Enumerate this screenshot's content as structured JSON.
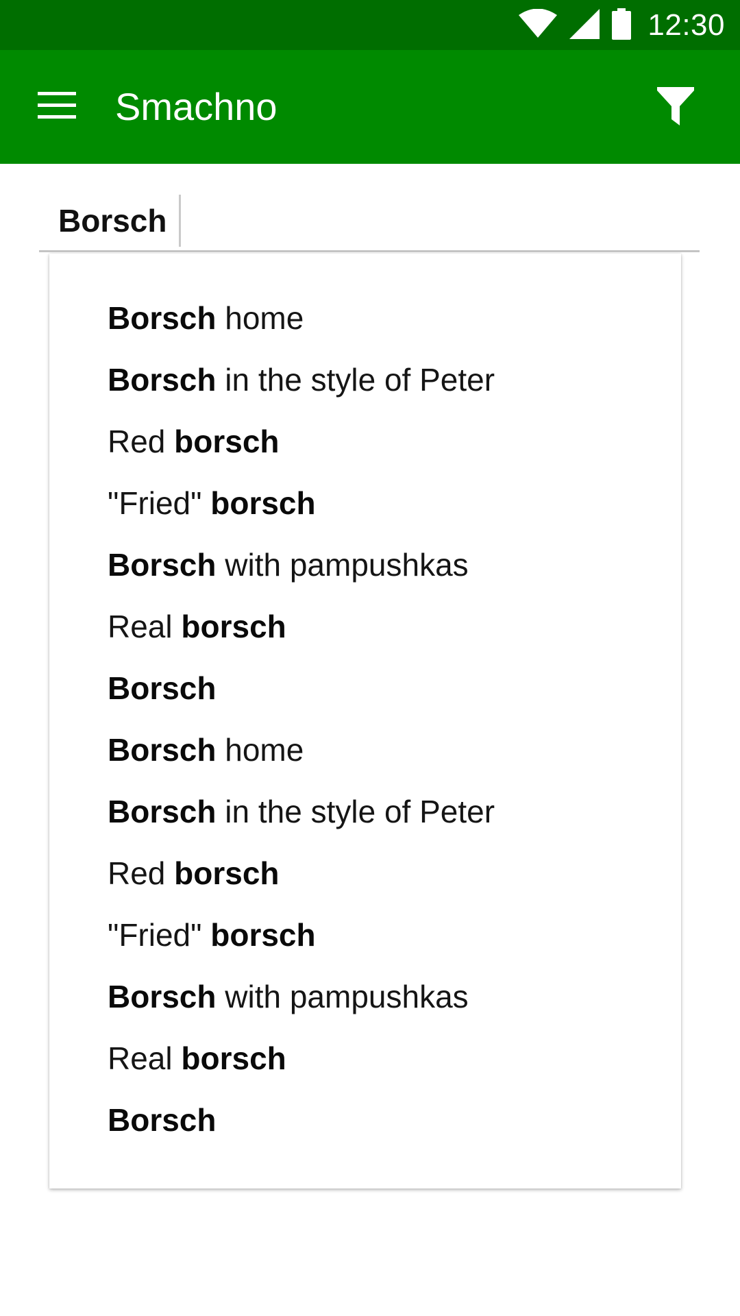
{
  "status_bar": {
    "time": "12:30",
    "icons": [
      "wifi-icon",
      "cellular-signal-icon",
      "battery-icon"
    ],
    "color": "#006e00"
  },
  "app_bar": {
    "title": "Smachno",
    "menu_icon": "hamburger-menu-icon",
    "filter_icon": "filter-funnel-icon",
    "color": "#008a00"
  },
  "search": {
    "value": "Borsch"
  },
  "suggestions": [
    {
      "prefix": "",
      "bold": "Borsch",
      "suffix": " home"
    },
    {
      "prefix": "",
      "bold": "Borsch",
      "suffix": " in the style of Peter"
    },
    {
      "prefix": "Red ",
      "bold": "borsch",
      "suffix": ""
    },
    {
      "prefix": "\"Fried\" ",
      "bold": "borsch",
      "suffix": ""
    },
    {
      "prefix": "",
      "bold": "Borsch",
      "suffix": " with pampushkas"
    },
    {
      "prefix": "Real ",
      "bold": "borsch",
      "suffix": ""
    },
    {
      "prefix": "",
      "bold": "Borsch",
      "suffix": ""
    },
    {
      "prefix": "",
      "bold": "Borsch",
      "suffix": " home"
    },
    {
      "prefix": "",
      "bold": "Borsch",
      "suffix": " in the style of Peter"
    },
    {
      "prefix": "Red ",
      "bold": "borsch",
      "suffix": ""
    },
    {
      "prefix": "\"Fried\" ",
      "bold": "borsch",
      "suffix": ""
    },
    {
      "prefix": "",
      "bold": "Borsch",
      "suffix": " with pampushkas"
    },
    {
      "prefix": "Real ",
      "bold": "borsch",
      "suffix": ""
    },
    {
      "prefix": "",
      "bold": "Borsch",
      "suffix": ""
    }
  ]
}
